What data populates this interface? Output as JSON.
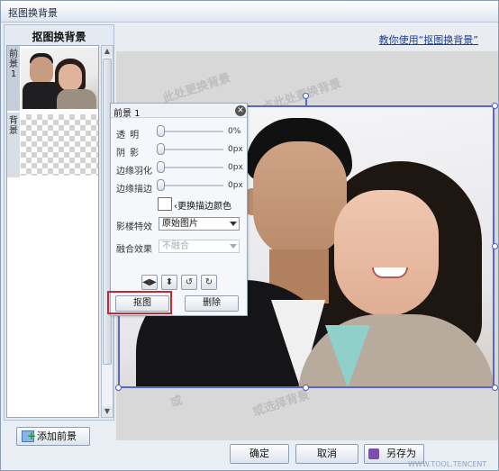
{
  "window": {
    "title": "抠图换背景"
  },
  "left_panel": {
    "heading": "抠图换背景",
    "layers": [
      {
        "tag": "前景1",
        "thumbnail": "photo-of-couple",
        "selected": true
      },
      {
        "tag": "背景",
        "thumbnail": "transparent-checkerboard",
        "selected": false
      }
    ],
    "add_button": "添加前景"
  },
  "canvas": {
    "help_link": "教你使用“抠图换背景”",
    "watermarks": [
      "此处更换背景",
      "点此处更换背景",
      "或选择背景",
      "或"
    ]
  },
  "popup": {
    "title": "前景 1",
    "sliders": [
      {
        "label": "透 明",
        "value": "0%"
      },
      {
        "label": "阴 影",
        "value": "0px"
      },
      {
        "label": "边缘羽化",
        "value": "0px"
      },
      {
        "label": "边缘描边",
        "value": "0px"
      }
    ],
    "border_color_label": "更换描边颜色",
    "effect": {
      "label": "影楼特效",
      "selected": "原始图片"
    },
    "blend": {
      "label": "融合效果",
      "selected": "不融合",
      "disabled": true
    },
    "tools": [
      "flip-horizontal-icon",
      "flip-vertical-icon",
      "rotate-left-icon",
      "rotate-right-icon"
    ],
    "cutout_button": "抠图",
    "delete_button": "删除"
  },
  "footer": {
    "confirm": "确定",
    "cancel": "取消",
    "save_as": "另存为",
    "corner_watermark": "WWW.TOOL.TENCENT"
  },
  "colors": {
    "selection": "#5766d1",
    "highlight": "#c8282f",
    "link": "#1a3f9a"
  }
}
